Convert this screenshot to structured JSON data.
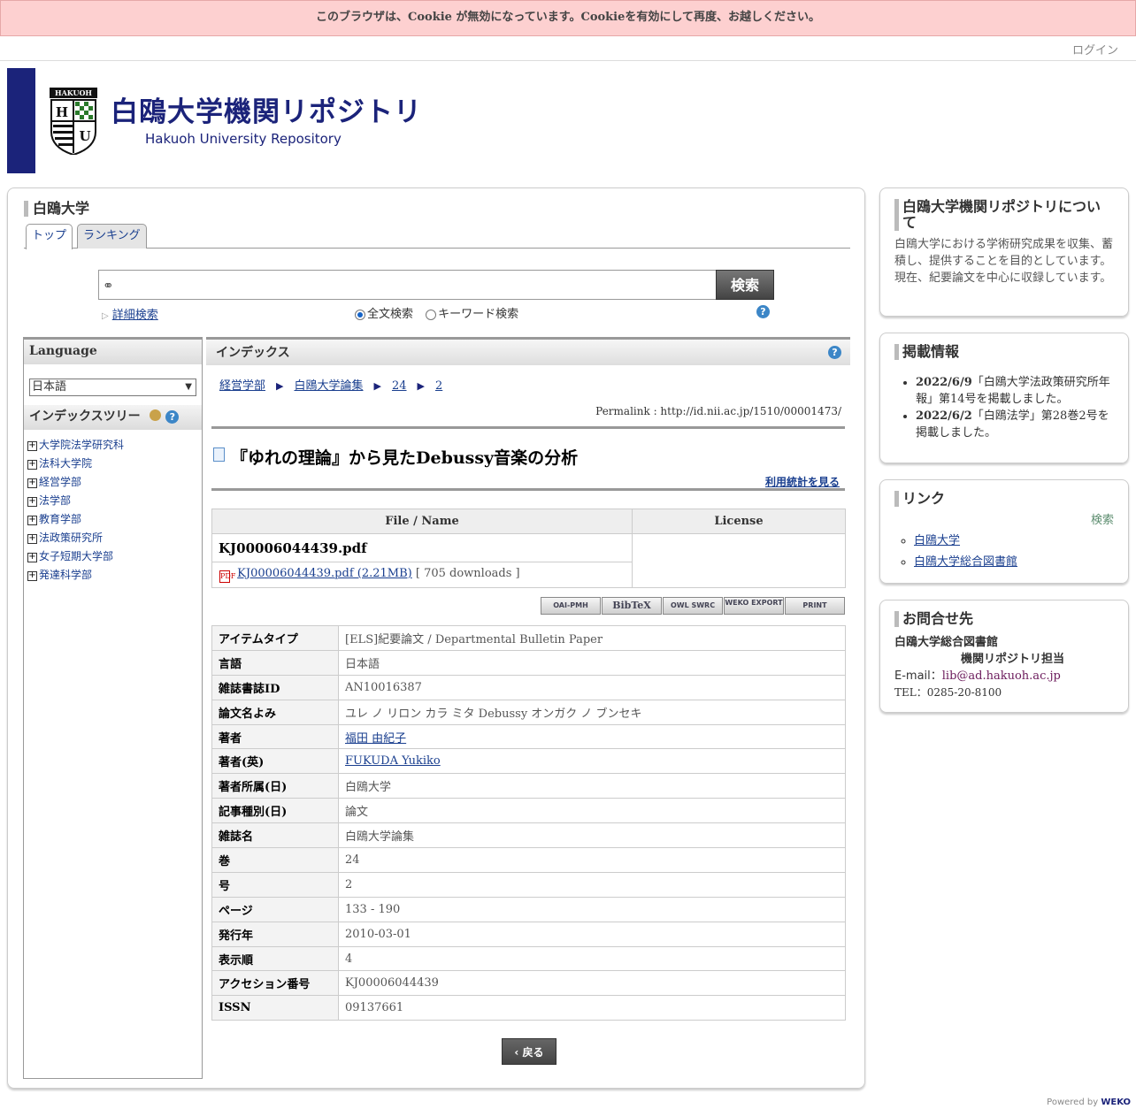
{
  "cookie_notice": "このブラウザは、Cookie が無効になっています。Cookieを有効にして再度、お越しください。",
  "login": "ログイン",
  "logo": {
    "jp": "白鴎大学機関リポジトリ",
    "en": "Hakuoh University Repository",
    "crest_text": "HAKUOH"
  },
  "main": {
    "title": "白鴎大学",
    "tabs": [
      "トップ",
      "ランキング"
    ],
    "search": {
      "placeholder": "",
      "button": "検索",
      "advanced": "詳細検索",
      "full_text": "全文検索",
      "keyword": "キーワード検索",
      "selected": "full_text"
    }
  },
  "language": {
    "heading": "Language",
    "selected": "日本語"
  },
  "index_tree": {
    "heading": "インデックスツリー",
    "items": [
      "大学院法学研究科",
      "法科大学院",
      "経営学部",
      "法学部",
      "教育学部",
      "法政策研究所",
      "女子短期大学部",
      "発達科学部"
    ]
  },
  "content": {
    "heading": "インデックス",
    "breadcrumb": [
      "経営学部",
      "白鴎大学論集",
      "24",
      "2"
    ],
    "permalink": "Permalink : http://id.nii.ac.jp/1510/00001473/",
    "title": "『ゆれの理論』から見たDebussy音楽の分析",
    "stats_link": "利用統計を見る",
    "file_table": {
      "headers": [
        "File / Name",
        "License"
      ],
      "file_name": "KJ00006044439.pdf",
      "link": "KJ00006044439.pdf  (2.21MB)",
      "downloads": "[ 705 downloads ]"
    },
    "export_buttons": [
      "OAI-PMH",
      "BibTeX",
      "OWL SWRC",
      "WEKO EXPORT",
      "PRINT"
    ],
    "metadata": [
      {
        "key": "アイテムタイプ",
        "value": "[ELS]紀要論文 / Departmental Bulletin Paper",
        "link": false
      },
      {
        "key": "言語",
        "value": "日本語",
        "link": false
      },
      {
        "key": "雑誌書誌ID",
        "value": "AN10016387",
        "link": false
      },
      {
        "key": "論文名よみ",
        "value": "ユレ ノ リロン カラ ミタ Debussy オンガク ノ ブンセキ",
        "link": false
      },
      {
        "key": "著者",
        "value": "福田 由紀子",
        "link": true
      },
      {
        "key": "著者(英)",
        "value": "FUKUDA Yukiko",
        "link": true
      },
      {
        "key": "著者所属(日)",
        "value": "白鴎大学",
        "link": false
      },
      {
        "key": "記事種別(日)",
        "value": "論文",
        "link": false
      },
      {
        "key": "雑誌名",
        "value": "白鴎大学論集",
        "link": false
      },
      {
        "key": "巻",
        "value": "24",
        "link": false
      },
      {
        "key": "号",
        "value": "2",
        "link": false
      },
      {
        "key": "ページ",
        "value": "133 - 190",
        "link": false
      },
      {
        "key": "発行年",
        "value": "2010-03-01",
        "link": false
      },
      {
        "key": "表示順",
        "value": "4",
        "link": false
      },
      {
        "key": "アクセション番号",
        "value": "KJ00006044439",
        "link": false
      },
      {
        "key": "ISSN",
        "value": "09137661",
        "link": false
      }
    ],
    "back": "戻る"
  },
  "sidebar": {
    "about": {
      "title": "白鴎大学機関リポジトリについて",
      "text1": "白鴎大学における学術研究成果を収集、蓄積し、提供することを目的としています。",
      "text2": "現在、紀要論文を中心に収録しています。"
    },
    "news": {
      "title": "掲載情報",
      "items": [
        {
          "date": "2022/6/9",
          "text": "「白鴎大学法政策研究所年報」第14号を掲載しました。"
        },
        {
          "date": "2022/6/2",
          "text": "「白鴎法学」第28巻2号を掲載しました。"
        }
      ]
    },
    "links": {
      "title": "リンク",
      "search": "検索",
      "items": [
        "白鴎大学",
        "白鴎大学総合図書館"
      ]
    },
    "contact": {
      "title": "お問合せ先",
      "org": "白鴎大学総合図書館",
      "dept": "機関リポジトリ担当",
      "email_label": "E-mail：",
      "email": "lib@ad.hakuoh.ac.jp",
      "tel": "TEL：0285-20-8100"
    }
  },
  "powered": {
    "label": "Powered by",
    "brand": "WEKO"
  }
}
